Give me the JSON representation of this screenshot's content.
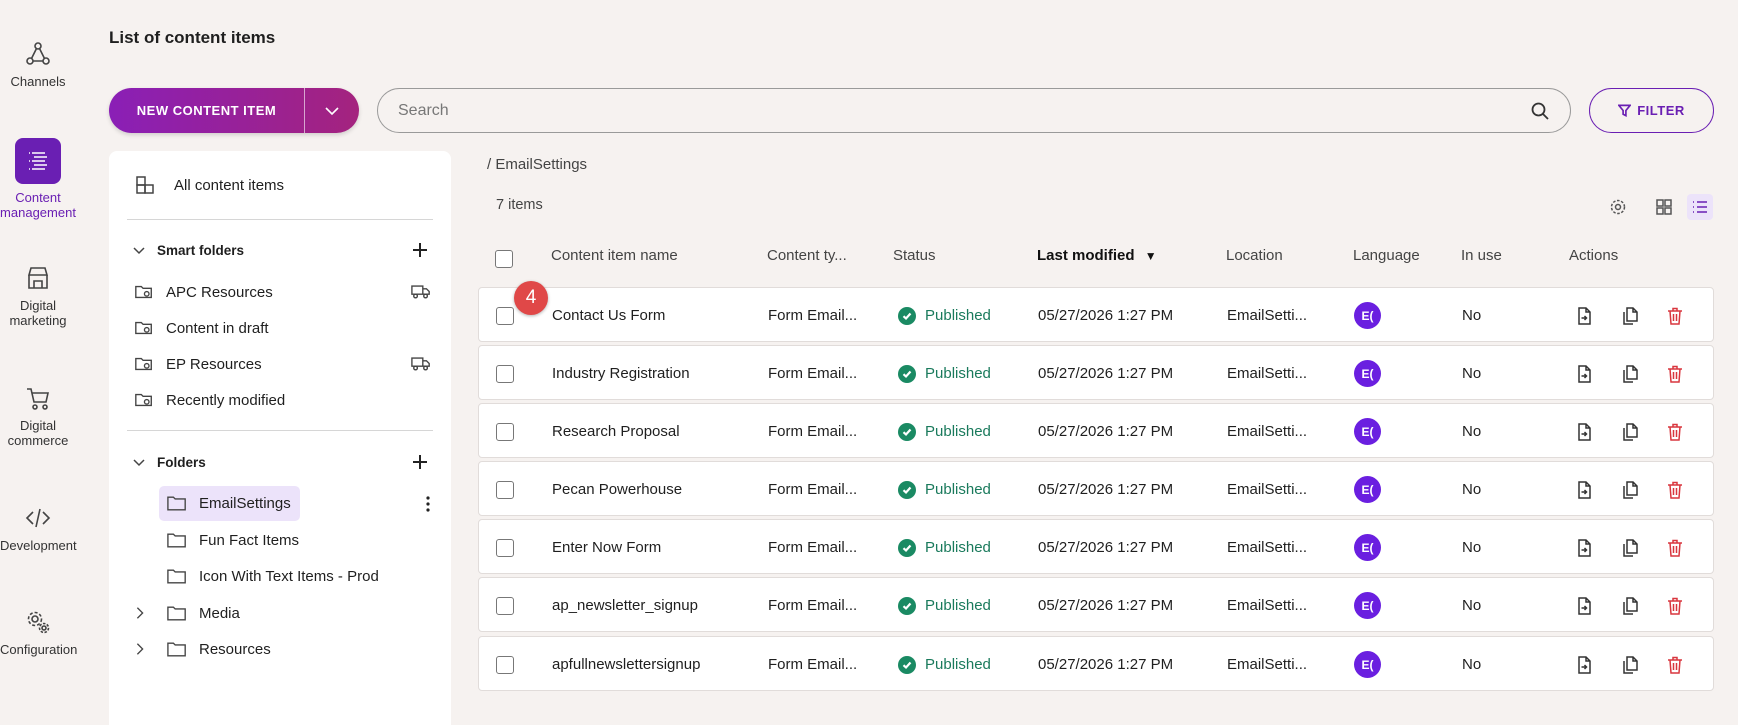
{
  "nav": [
    {
      "label": "Channels",
      "icon": "channels-icon"
    },
    {
      "label": "Content management",
      "icon": "content-management-icon"
    },
    {
      "label": "Digital marketing",
      "icon": "store-icon"
    },
    {
      "label": "Digital commerce",
      "icon": "cart-icon"
    },
    {
      "label": "Development",
      "icon": "code-icon"
    },
    {
      "label": "Configuration",
      "icon": "gears-icon"
    }
  ],
  "page_title": "List of content items",
  "toolbar": {
    "new_label": "NEW CONTENT ITEM",
    "search_placeholder": "Search",
    "filter_label": "FILTER"
  },
  "tree": {
    "all_items": "All content items",
    "smart_folders_label": "Smart folders",
    "smart_folders": [
      "APC Resources",
      "Content in draft",
      "EP Resources",
      "Recently modified"
    ],
    "folders_label": "Folders",
    "folders": [
      "EmailSettings",
      "Fun Fact Items",
      "Icon With Text Items - Prod",
      "Media",
      "Resources"
    ]
  },
  "breadcrumb": "/ EmailSettings",
  "item_count": "7 items",
  "columns": {
    "name": "Content item name",
    "type": "Content ty...",
    "status": "Status",
    "modified": "Last modified",
    "location": "Location",
    "language": "Language",
    "in_use": "In use",
    "actions": "Actions"
  },
  "rows": [
    {
      "name": "Contact Us Form",
      "type": "Form Email...",
      "status": "Published",
      "modified": "05/27/2026 1:27 PM",
      "location": "EmailSetti...",
      "language": "E(",
      "in_use": "No"
    },
    {
      "name": "Industry Registration",
      "type": "Form Email...",
      "status": "Published",
      "modified": "05/27/2026 1:27 PM",
      "location": "EmailSetti...",
      "language": "E(",
      "in_use": "No"
    },
    {
      "name": "Research Proposal",
      "type": "Form Email...",
      "status": "Published",
      "modified": "05/27/2026 1:27 PM",
      "location": "EmailSetti...",
      "language": "E(",
      "in_use": "No"
    },
    {
      "name": "Pecan Powerhouse",
      "type": "Form Email...",
      "status": "Published",
      "modified": "05/27/2026 1:27 PM",
      "location": "EmailSetti...",
      "language": "E(",
      "in_use": "No"
    },
    {
      "name": "Enter Now Form",
      "type": "Form Email...",
      "status": "Published",
      "modified": "05/27/2026 1:27 PM",
      "location": "EmailSetti...",
      "language": "E(",
      "in_use": "No"
    },
    {
      "name": "ap_newsletter_signup",
      "type": "Form Email...",
      "status": "Published",
      "modified": "05/27/2026 1:27 PM",
      "location": "EmailSetti...",
      "language": "E(",
      "in_use": "No"
    },
    {
      "name": "apfullnewslettersignup",
      "type": "Form Email...",
      "status": "Published",
      "modified": "05/27/2026 1:27 PM",
      "location": "EmailSetti...",
      "language": "E(",
      "in_use": "No"
    }
  ],
  "badge": "4",
  "colors": {
    "accent": "#6a1fb3",
    "published": "#1a8a63",
    "delete": "#d9363e",
    "language": "#6a1fe0"
  }
}
